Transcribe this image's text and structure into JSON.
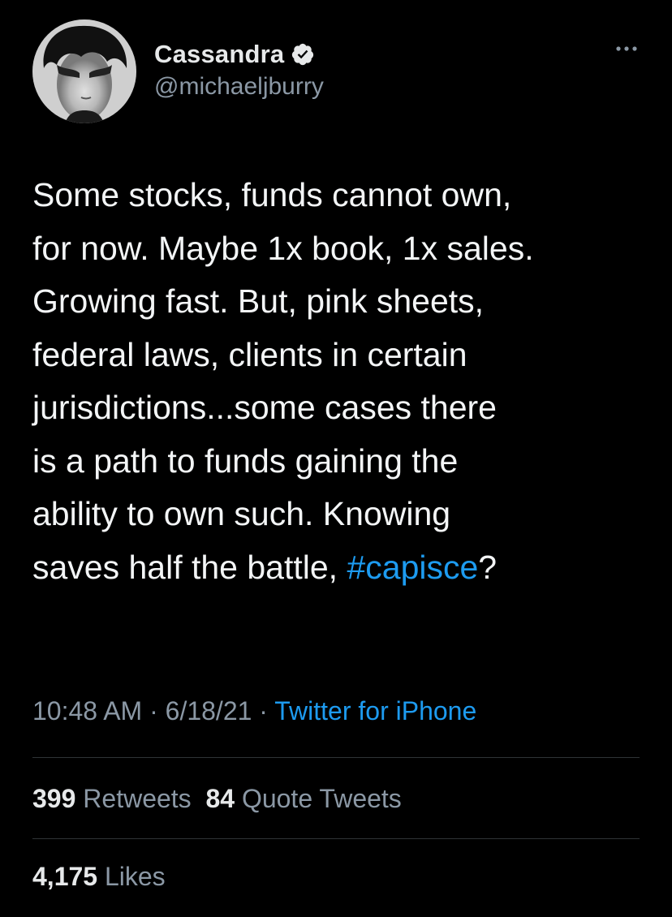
{
  "user": {
    "display_name": "Cassandra",
    "handle": "@michaeljburry",
    "verified": true
  },
  "tweet": {
    "text_before": "Some stocks, funds cannot own,\nfor now. Maybe 1x book, 1x sales.\nGrowing fast. But, pink sheets,\nfederal laws, clients in certain\njurisdictions...some cases there\nis a path to funds gaining the\nability to own such. Knowing\nsaves half the battle, ",
    "hashtag": "#capisce",
    "text_after": "?"
  },
  "meta": {
    "time": "10:48 AM",
    "date": "6/18/21",
    "separator": "·",
    "source": "Twitter for iPhone"
  },
  "stats": {
    "retweets_count": "399",
    "retweets_label": "Retweets",
    "quotes_count": "84",
    "quotes_label": "Quote Tweets",
    "likes_count": "4,175",
    "likes_label": "Likes"
  },
  "colors": {
    "background": "#000000",
    "text": "#e7e9ea",
    "secondary": "#8b98a5",
    "accent": "#1d9bf0",
    "divider": "#2f3336"
  },
  "icons": {
    "verified": "verified-badge-icon",
    "more": "more-options-icon"
  }
}
